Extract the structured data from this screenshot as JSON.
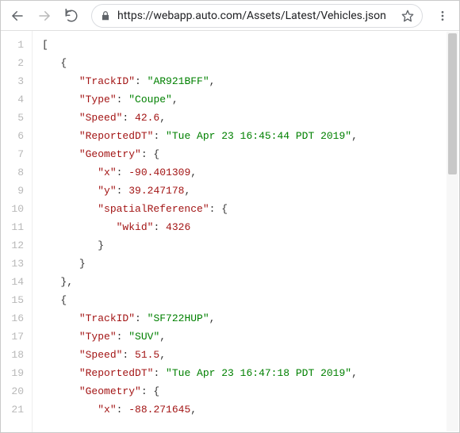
{
  "toolbar": {
    "url": "https://webapp.auto.com/Assets/Latest/Vehicles.json"
  },
  "icons": {
    "back": "back-arrow-icon",
    "forward": "forward-arrow-icon",
    "reload": "reload-icon",
    "lock": "lock-icon",
    "star": "star-icon",
    "menu": "menu-dots-icon"
  },
  "gutter": [
    "1",
    "2",
    "3",
    "4",
    "5",
    "6",
    "7",
    "8",
    "9",
    "10",
    "11",
    "12",
    "13",
    "14",
    "15",
    "16",
    "17",
    "18",
    "19",
    "20",
    "21"
  ],
  "json_lines": [
    {
      "indent": 0,
      "tokens": [
        {
          "t": "punc",
          "v": "["
        }
      ]
    },
    {
      "indent": 1,
      "tokens": [
        {
          "t": "punc",
          "v": "{"
        }
      ]
    },
    {
      "indent": 2,
      "tokens": [
        {
          "t": "key",
          "v": "\"TrackID\""
        },
        {
          "t": "punc",
          "v": ": "
        },
        {
          "t": "str",
          "v": "\"AR921BFF\""
        },
        {
          "t": "punc",
          "v": ","
        }
      ]
    },
    {
      "indent": 2,
      "tokens": [
        {
          "t": "key",
          "v": "\"Type\""
        },
        {
          "t": "punc",
          "v": ": "
        },
        {
          "t": "str",
          "v": "\"Coupe\""
        },
        {
          "t": "punc",
          "v": ","
        }
      ]
    },
    {
      "indent": 2,
      "tokens": [
        {
          "t": "key",
          "v": "\"Speed\""
        },
        {
          "t": "punc",
          "v": ": "
        },
        {
          "t": "num",
          "v": "42.6"
        },
        {
          "t": "punc",
          "v": ","
        }
      ]
    },
    {
      "indent": 2,
      "tokens": [
        {
          "t": "key",
          "v": "\"ReportedDT\""
        },
        {
          "t": "punc",
          "v": ": "
        },
        {
          "t": "str",
          "v": "\"Tue Apr 23 16:45:44 PDT 2019\""
        },
        {
          "t": "punc",
          "v": ","
        }
      ]
    },
    {
      "indent": 2,
      "tokens": [
        {
          "t": "key",
          "v": "\"Geometry\""
        },
        {
          "t": "punc",
          "v": ": {"
        }
      ]
    },
    {
      "indent": 3,
      "tokens": [
        {
          "t": "key",
          "v": "\"x\""
        },
        {
          "t": "punc",
          "v": ": "
        },
        {
          "t": "num",
          "v": "-90.401309"
        },
        {
          "t": "punc",
          "v": ","
        }
      ]
    },
    {
      "indent": 3,
      "tokens": [
        {
          "t": "key",
          "v": "\"y\""
        },
        {
          "t": "punc",
          "v": ": "
        },
        {
          "t": "num",
          "v": "39.247178"
        },
        {
          "t": "punc",
          "v": ","
        }
      ]
    },
    {
      "indent": 3,
      "tokens": [
        {
          "t": "key",
          "v": "\"spatialReference\""
        },
        {
          "t": "punc",
          "v": ": {"
        }
      ]
    },
    {
      "indent": 4,
      "tokens": [
        {
          "t": "key",
          "v": "\"wkid\""
        },
        {
          "t": "punc",
          "v": ": "
        },
        {
          "t": "num",
          "v": "4326"
        }
      ]
    },
    {
      "indent": 3,
      "tokens": [
        {
          "t": "punc",
          "v": "}"
        }
      ]
    },
    {
      "indent": 2,
      "tokens": [
        {
          "t": "punc",
          "v": "}"
        }
      ]
    },
    {
      "indent": 1,
      "tokens": [
        {
          "t": "punc",
          "v": "},"
        }
      ]
    },
    {
      "indent": 1,
      "tokens": [
        {
          "t": "punc",
          "v": "{"
        }
      ]
    },
    {
      "indent": 2,
      "tokens": [
        {
          "t": "key",
          "v": "\"TrackID\""
        },
        {
          "t": "punc",
          "v": ": "
        },
        {
          "t": "str",
          "v": "\"SF722HUP\""
        },
        {
          "t": "punc",
          "v": ","
        }
      ]
    },
    {
      "indent": 2,
      "tokens": [
        {
          "t": "key",
          "v": "\"Type\""
        },
        {
          "t": "punc",
          "v": ": "
        },
        {
          "t": "str",
          "v": "\"SUV\""
        },
        {
          "t": "punc",
          "v": ","
        }
      ]
    },
    {
      "indent": 2,
      "tokens": [
        {
          "t": "key",
          "v": "\"Speed\""
        },
        {
          "t": "punc",
          "v": ": "
        },
        {
          "t": "num",
          "v": "51.5"
        },
        {
          "t": "punc",
          "v": ","
        }
      ]
    },
    {
      "indent": 2,
      "tokens": [
        {
          "t": "key",
          "v": "\"ReportedDT\""
        },
        {
          "t": "punc",
          "v": ": "
        },
        {
          "t": "str",
          "v": "\"Tue Apr 23 16:47:18 PDT 2019\""
        },
        {
          "t": "punc",
          "v": ","
        }
      ]
    },
    {
      "indent": 2,
      "tokens": [
        {
          "t": "key",
          "v": "\"Geometry\""
        },
        {
          "t": "punc",
          "v": ": {"
        }
      ]
    },
    {
      "indent": 3,
      "tokens": [
        {
          "t": "key",
          "v": "\"x\""
        },
        {
          "t": "punc",
          "v": ": "
        },
        {
          "t": "num",
          "v": "-88.271645"
        },
        {
          "t": "punc",
          "v": ","
        }
      ]
    }
  ]
}
